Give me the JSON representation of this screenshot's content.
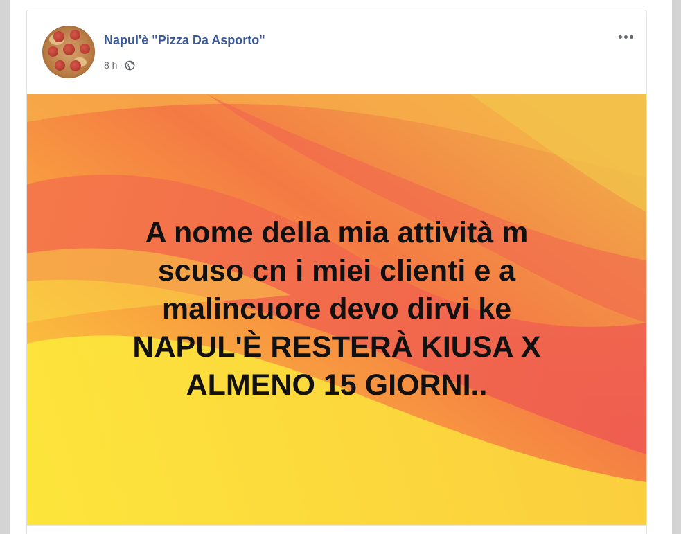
{
  "post": {
    "page_name": "Napul'è \"Pizza Da Asporto\"",
    "time": "8 h",
    "separator": "·",
    "privacy_icon": "globe-icon",
    "more_icon": "more-options-icon",
    "avatar_icon": "pizza-avatar",
    "banner_lines": [
      "A nome della mia attività m",
      "scuso cn i miei clienti e a",
      "malincuore devo dirvi ke",
      "NAPUL'È RESTERÀ KIUSA X",
      "ALMENO 15 GIORNI.."
    ]
  },
  "colors": {
    "page_name": "#385898",
    "meta_text": "#616770",
    "banner_text": "#111111",
    "gradient_yellow": "#fde23a",
    "gradient_orange": "#f6923a",
    "gradient_red": "#ef5c4e"
  }
}
